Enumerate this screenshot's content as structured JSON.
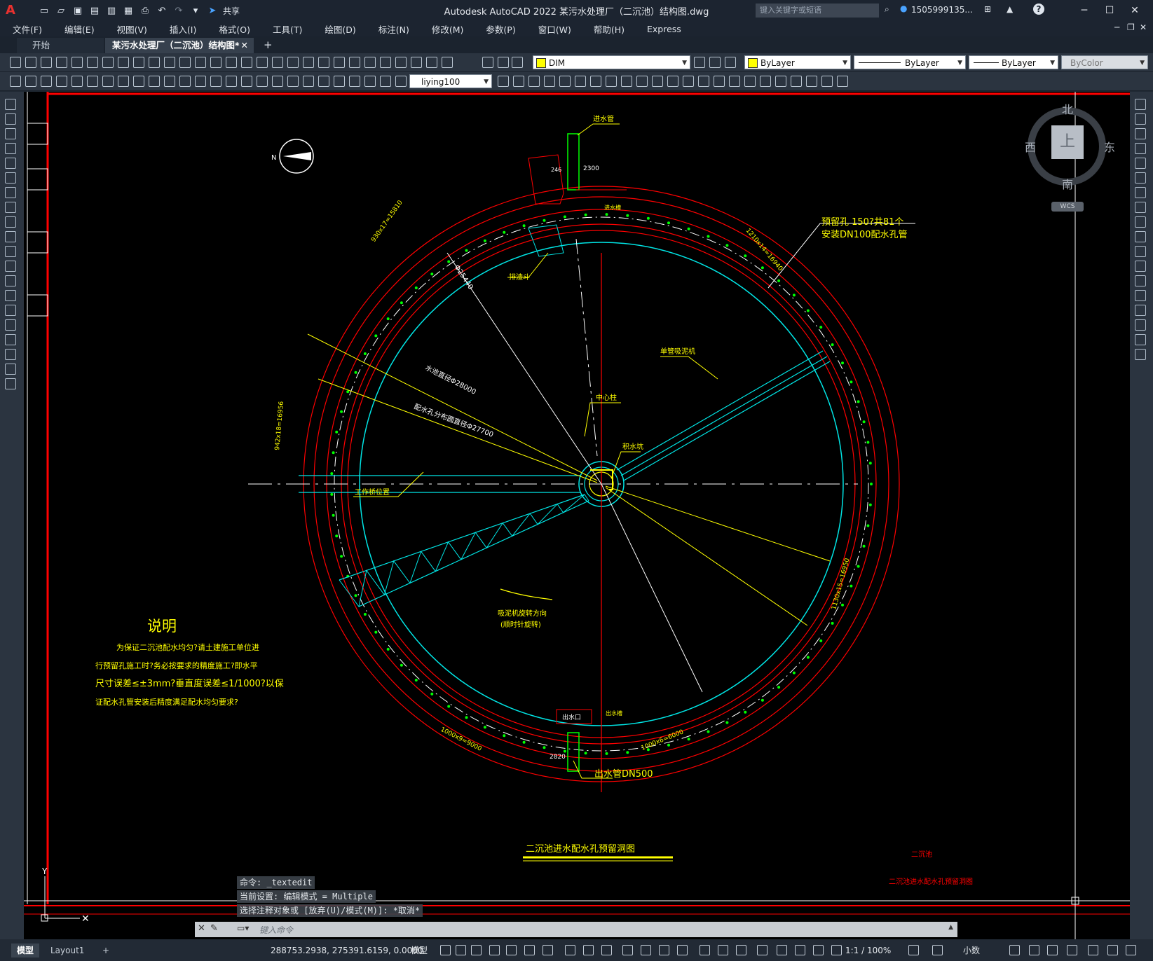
{
  "app": {
    "window_title": "Autodesk AutoCAD 2022    某污水处理厂（二沉池）结构图.dwg",
    "search_placeholder": "键入关键字或短语",
    "user": "1505999135...",
    "share_label": "共享"
  },
  "menu": [
    "文件(F)",
    "编辑(E)",
    "视图(V)",
    "插入(I)",
    "格式(O)",
    "工具(T)",
    "绘图(D)",
    "标注(N)",
    "修改(M)",
    "参数(P)",
    "窗口(W)",
    "帮助(H)",
    "Express"
  ],
  "tabs": [
    {
      "label": "开始"
    },
    {
      "label": "某污水处理厂（二沉池）结构图*"
    }
  ],
  "toolbar": {
    "layer_value": "DIM",
    "color_value": "ByLayer",
    "linetype_value": "ByLayer",
    "lineweight_value": "ByLayer",
    "plotstyle_value": "ByColor",
    "dimstyle_value": "liying100"
  },
  "viewcube": {
    "north": "北",
    "south": "南",
    "east": "东",
    "west": "西",
    "top": "上",
    "wcs": "WCS"
  },
  "drawing": {
    "north_arrow_letter": "N",
    "labels": {
      "inlet_pipe": "进水管",
      "dim_top": "2300",
      "dim_246": "246",
      "inlet_tank": "进水槽",
      "reserved_hole_1": "预留孔  150?共81个",
      "reserved_hole_2": "安装DN100配水孔管",
      "arc_dim_tr": "1210x14=16940",
      "arc_dim_tl": "930x17=15810",
      "scum_hopper": "排渣斗",
      "dia_inner": "Φ25440",
      "pool_dia": "水池直径Φ28000",
      "distribution_dia": "配水孔分布圆直径Φ27700",
      "single_pipe_suction": "单管吸泥机",
      "center_column": "中心柱",
      "sump": "积水坑",
      "arc_dim_left": "942x18=16956",
      "bridge_position": "工作桥位置",
      "rotation_1": "吸泥机旋转方向",
      "rotation_2": "(顺时针旋转)",
      "arc_dim_right": "1130x15=16950",
      "outlet": "出水口",
      "outlet_tank": "出水槽",
      "arc_dim_bl": "1000x9=9000",
      "arc_dim_br": "1000x6=6000",
      "dim_bottom": "2820",
      "outlet_pipe": "出水管DN500",
      "main_title": "二沉池进水配水孔预留洞图",
      "title_block_1": "二沉池",
      "title_block_2": "二沉池进水配水孔预留洞图"
    },
    "notes": {
      "heading": "说明",
      "line1": "为保证二沉池配水均匀?请土建施工单位进",
      "line2": "行预留孔施工时?务必按要求的精度施工?即水平",
      "line3": "尺寸误差≤±3mm?垂直度误差≤1/1000?以保",
      "line4": "证配水孔管安装后精度满足配水均匀要求?"
    },
    "ucs_y": "Y"
  },
  "command": {
    "history": [
      "命令: _textedit",
      "当前设置: 编辑模式 = Multiple",
      "选择注释对象或 [放弃(U)/模式(M)]: *取消*"
    ],
    "placeholder": "键入命令"
  },
  "status": {
    "tab_model": "模型",
    "tab_layout": "Layout1",
    "coords": "288753.2938, 275391.6159, 0.0000",
    "space": "模型",
    "scale": "1:1 / 100%",
    "units": "小数"
  },
  "colors": {
    "red": "#ff0000",
    "cyan": "#00e5e5",
    "yellow": "#ffff00",
    "green": "#00ff00",
    "white": "#ffffff"
  }
}
